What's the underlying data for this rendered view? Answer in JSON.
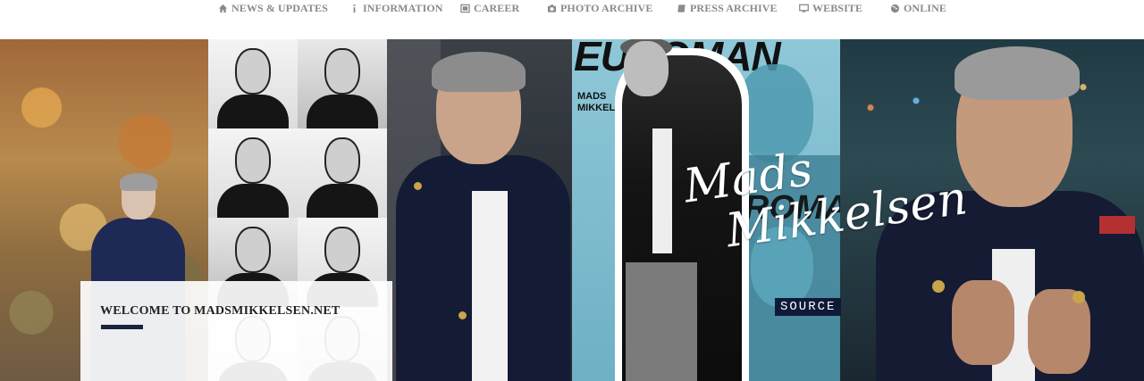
{
  "nav": {
    "items": [
      {
        "label": "NEWS & UPDATES",
        "icon": "home-icon"
      },
      {
        "label": "INFORMATION",
        "icon": "info-icon"
      },
      {
        "label": "CAREER",
        "icon": "film-icon"
      },
      {
        "label": "PHOTO ARCHIVE",
        "icon": "camera-icon"
      },
      {
        "label": "PRESS ARCHIVE",
        "icon": "book-icon"
      },
      {
        "label": "WEBSITE",
        "icon": "monitor-icon"
      },
      {
        "label": "ONLINE",
        "icon": "globe-icon"
      }
    ]
  },
  "header": {
    "magazine_masthead": "EUROMAN",
    "cover_name_line1": "MADS",
    "cover_name_line2": "MIKKELSEN",
    "signature_line1": "Mads",
    "signature_line2": "Mikkelsen",
    "source_badge": "SOURCE",
    "accent_color": "#1a2240"
  },
  "welcome": {
    "title": "WELCOME TO MADSMIKKELSEN.NET"
  }
}
